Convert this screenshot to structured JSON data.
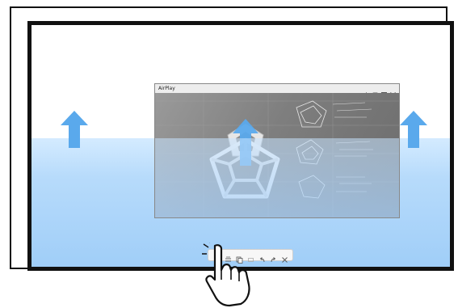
{
  "window": {
    "title": "AirPlay",
    "controls": [
      "volume-icon",
      "screenshot-icon",
      "fullscreen-icon",
      "close-icon"
    ]
  },
  "toolbar": {
    "items": [
      "menu-icon",
      "pen-icon",
      "copy-icon",
      "eraser-icon",
      "undo-icon",
      "redo-icon",
      "close-icon"
    ]
  },
  "colors": {
    "arrow": "#5aa9ec",
    "water": "#b7dbfb",
    "frame": "#111111"
  }
}
